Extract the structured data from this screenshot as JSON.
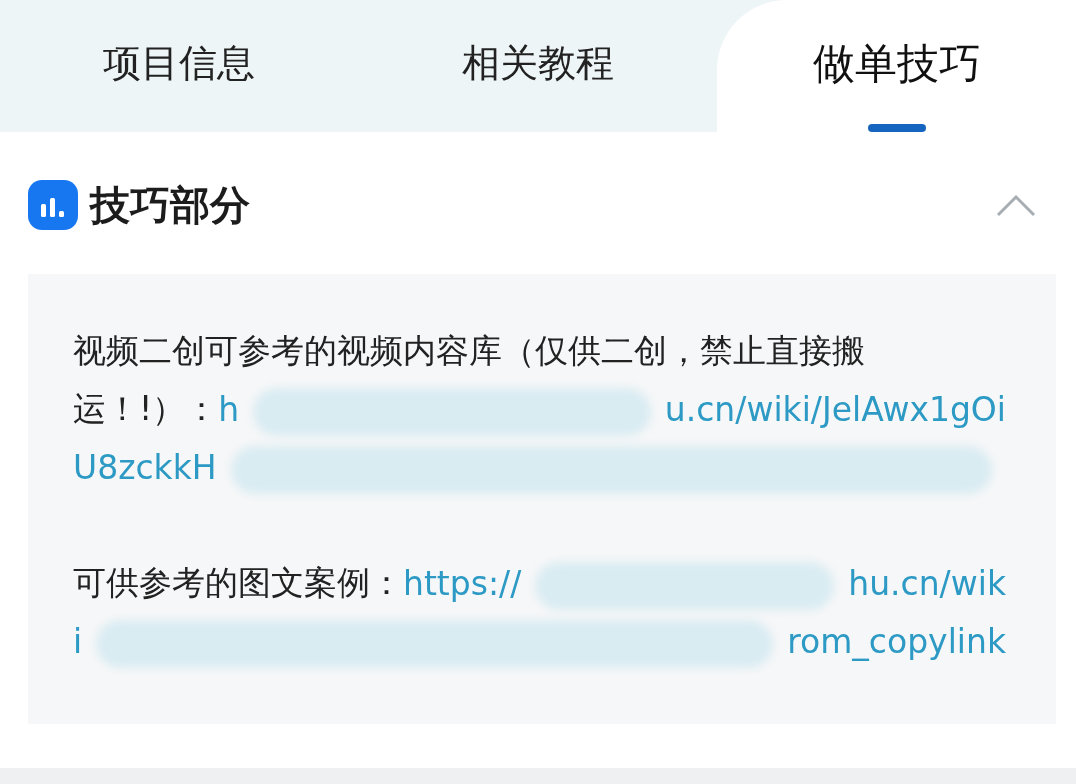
{
  "tabs": [
    {
      "label": "项目信息",
      "selected": false
    },
    {
      "label": "相关教程",
      "selected": false
    },
    {
      "label": "做单技巧",
      "selected": true
    }
  ],
  "section": {
    "title": "技巧部分",
    "expanded": true,
    "paragraphs": [
      {
        "lines": [
          [
            {
              "kind": "text",
              "text": "视频二创可参考的视频内容库（仅供二创，禁止直接搬"
            }
          ],
          [
            {
              "kind": "text",
              "text": "运！!）："
            },
            {
              "kind": "link",
              "text": "h"
            },
            {
              "kind": "blur"
            },
            {
              "kind": "link",
              "text": "u.cn/wiki/JelAwx1gOi"
            }
          ],
          [
            {
              "kind": "link",
              "text": "U8zckkH"
            },
            {
              "kind": "blur"
            }
          ]
        ]
      },
      {
        "lines": [
          [
            {
              "kind": "text",
              "text": "可供参考的图文案例："
            },
            {
              "kind": "link",
              "text": "https://"
            },
            {
              "kind": "blur"
            },
            {
              "kind": "link",
              "text": "hu.cn/wik"
            }
          ],
          [
            {
              "kind": "link",
              "text": "i"
            },
            {
              "kind": "blur"
            },
            {
              "kind": "link",
              "text": "rom_copylink"
            }
          ]
        ]
      }
    ]
  }
}
